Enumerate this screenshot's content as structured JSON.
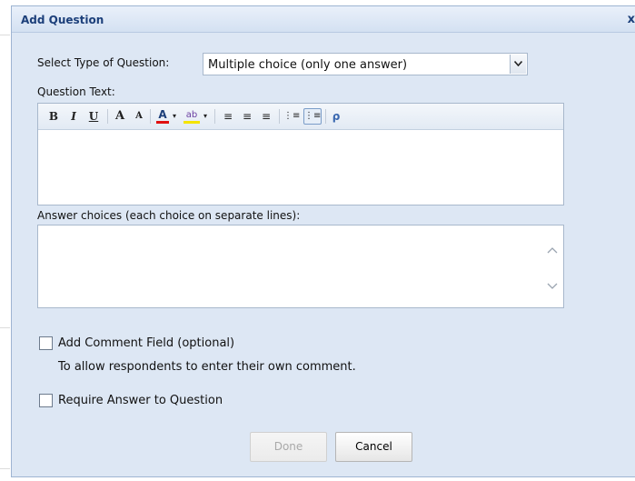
{
  "dialog": {
    "title": "Add Question",
    "close_glyph": "x"
  },
  "question_type": {
    "label": "Select Type of Question:",
    "selected": "Multiple choice (only one answer)"
  },
  "question_text": {
    "label": "Question Text:",
    "toolbar": {
      "bold": "B",
      "italic": "I",
      "underline": "U",
      "grow_font": "A",
      "shrink_font": "A",
      "font_color": "A",
      "highlight": "ab",
      "align_left": "≡",
      "align_center": "≡",
      "align_right": "≡",
      "numbered_list": "⋮≡",
      "bulleted_list": "⋮≡",
      "spellcheck": "ρ"
    }
  },
  "answer_choices": {
    "label": "Answer choices (each choice on separate lines):"
  },
  "options": {
    "comment_label": "Add Comment Field (optional)",
    "comment_hint": "To allow respondents to enter their own comment.",
    "require_label": "Require Answer to Question"
  },
  "buttons": {
    "done": "Done",
    "cancel": "Cancel"
  },
  "colors": {
    "dialog_bg": "#dde7f4",
    "title_text": "#1c3f7a",
    "font_color_bar": "#e01010",
    "highlight_bar": "#f5e400"
  }
}
